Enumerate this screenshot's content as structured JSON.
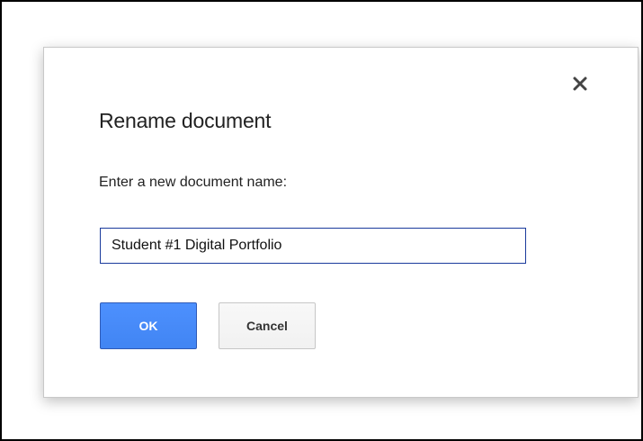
{
  "dialog": {
    "title": "Rename document",
    "prompt": "Enter a new document name:",
    "input_value": "Student #1 Digital Portfolio",
    "ok_label": "OK",
    "cancel_label": "Cancel",
    "close_icon": "close-icon"
  },
  "colors": {
    "accent": "#4d90fe",
    "input_border": "#1a3a9c"
  }
}
